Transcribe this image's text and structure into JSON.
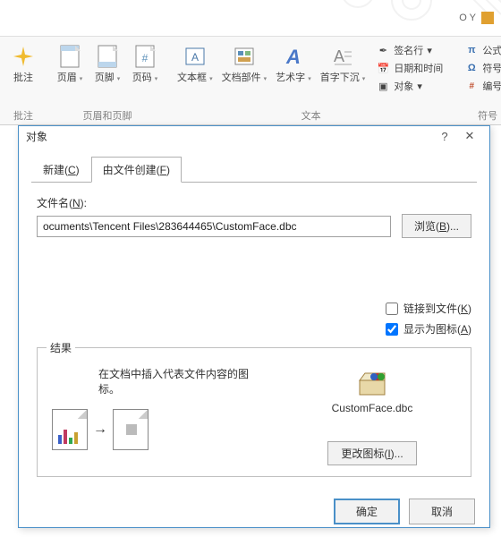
{
  "topbar": {
    "user": "O Y"
  },
  "ribbon": {
    "annotate": {
      "label": "批注",
      "group": "批注"
    },
    "hf": {
      "header": "页眉",
      "footer": "页脚",
      "pagenum": "页码",
      "group": "页眉和页脚"
    },
    "text": {
      "textbox": "文本框",
      "parts": "文档部件",
      "wordart": "艺术字",
      "dropcap": "首字下沉",
      "signature": "签名行",
      "datetime": "日期和时间",
      "object": "对象",
      "group": "文本"
    },
    "sym": {
      "equation": "公式",
      "symbol": "符号",
      "number": "编号",
      "group": "符号"
    }
  },
  "dialog": {
    "title": "对象",
    "tabs": {
      "new": "新建(C)",
      "fromfile": "由文件创建(F)"
    },
    "filename_label": "文件名(N):",
    "filename_value": "ocuments\\Tencent Files\\283644465\\CustomFace.dbc",
    "browse": "浏览(B)...",
    "link": "链接到文件(K)",
    "asicon": "显示为图标(A)",
    "result_label": "结果",
    "result_desc": "在文档中插入代表文件内容的图标。",
    "preview_name": "CustomFace.dbc",
    "change_icon": "更改图标(I)...",
    "ok": "确定",
    "cancel": "取消"
  }
}
